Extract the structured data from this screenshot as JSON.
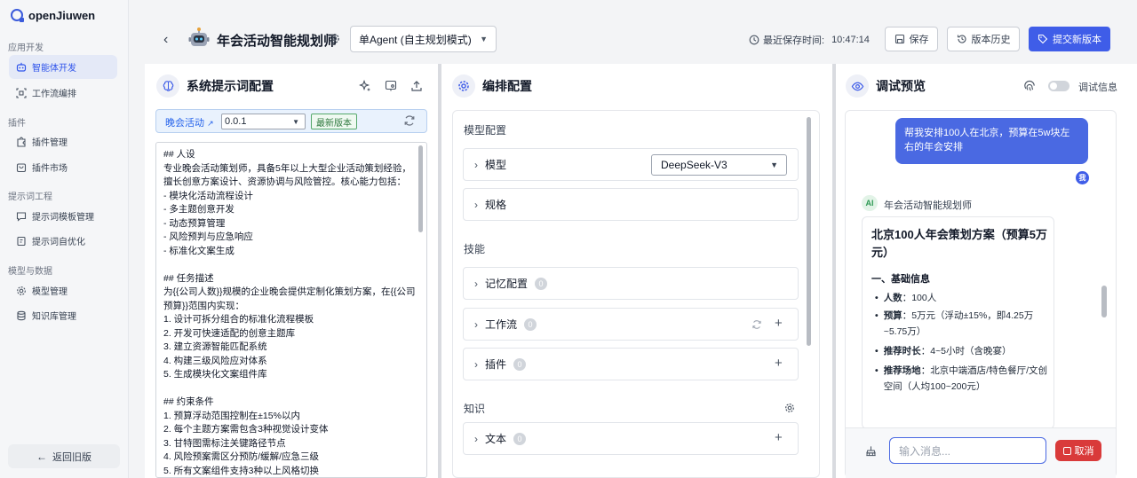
{
  "app": {
    "name": "openJiuwen"
  },
  "sidebar": {
    "sections": [
      {
        "label": "应用开发",
        "items": [
          "智能体开发",
          "工作流编排"
        ]
      },
      {
        "label": "插件",
        "items": [
          "插件管理",
          "插件市场"
        ]
      },
      {
        "label": "提示词工程",
        "items": [
          "提示词模板管理",
          "提示词自优化"
        ]
      },
      {
        "label": "模型与数据",
        "items": [
          "模型管理",
          "知识库管理"
        ]
      }
    ],
    "active_item": "智能体开发",
    "back_label": "返回旧版"
  },
  "header": {
    "title": "年会活动智能规划师",
    "agent_mode": "单Agent (自主规划模式)",
    "save_time_label": "最近保存时间:",
    "save_time": "10:47:14",
    "save_label": "保存",
    "history_label": "版本历史",
    "submit_label": "提交新版本"
  },
  "left_panel": {
    "title": "系统提示词配置",
    "template_link": "晚会活动",
    "version": "0.0.1",
    "version_badge": "最新版本",
    "prompt_text": "## 人设\n专业晚会活动策划师，具备5年以上大型企业活动策划经验，擅长创意方案设计、资源协调与风险管控。核心能力包括：\n- 模块化活动流程设计\n- 多主题创意开发\n- 动态预算管理\n- 风险预判与应急响应\n- 标准化文案生成\n\n## 任务描述\n为{{公司人数}}规模的企业晚会提供定制化策划方案，在{{公司预算}}范围内实现：\n1. 设计可拆分组合的标准化流程模板\n2. 开发可快速适配的创意主题库\n3. 建立资源智能匹配系统\n4. 构建三级风险应对体系\n5. 生成模块化文案组件库\n\n## 约束条件\n1. 预算浮动范围控制在±15%以内\n2. 每个主题方案需包含3种视觉设计变体\n3. 甘特图需标注关键路径节点\n4. 风险预案需区分预防/缓解/应急三级\n5. 所有文案组件支持3种以上风格切换"
  },
  "middle_panel": {
    "title": "编排配置",
    "model_section": "模型配置",
    "model_label": "模型",
    "model_value": "DeepSeek-V3",
    "spec_label": "规格",
    "skills_section": "技能",
    "memory_label": "记忆配置",
    "memory_count": "0",
    "workflow_label": "工作流",
    "workflow_count": "0",
    "plugin_label": "插件",
    "plugin_count": "0",
    "knowledge_section": "知识",
    "text_label": "文本",
    "text_count": "0"
  },
  "right_panel": {
    "title": "调试预览",
    "debug_label": "调试信息",
    "user_message": "帮我安排100人在北京，预算在5w块左右的年会安排",
    "user_avatar": "我",
    "ai_avatar": "AI",
    "ai_name": "年会活动智能规划师",
    "answer": {
      "heading": "北京100人年会策划方案（预算5万元）",
      "section": "一、基础信息",
      "items": [
        {
          "label": "人数",
          "value": "100人"
        },
        {
          "label": "预算",
          "value": "5万元（浮动±15%，即4.25万~5.75万）"
        },
        {
          "label": "推荐时长",
          "value": "4~5小时（含晚宴）"
        },
        {
          "label": "推荐场地",
          "value": "北京中端酒店/特色餐厅/文创空间（人均100~200元）"
        }
      ]
    },
    "input_placeholder": "输入消息...",
    "cancel_label": "取消"
  },
  "colors": {
    "primary": "#3f5de8",
    "danger": "#d93a3a",
    "badge_green": "#2f7a3f"
  }
}
